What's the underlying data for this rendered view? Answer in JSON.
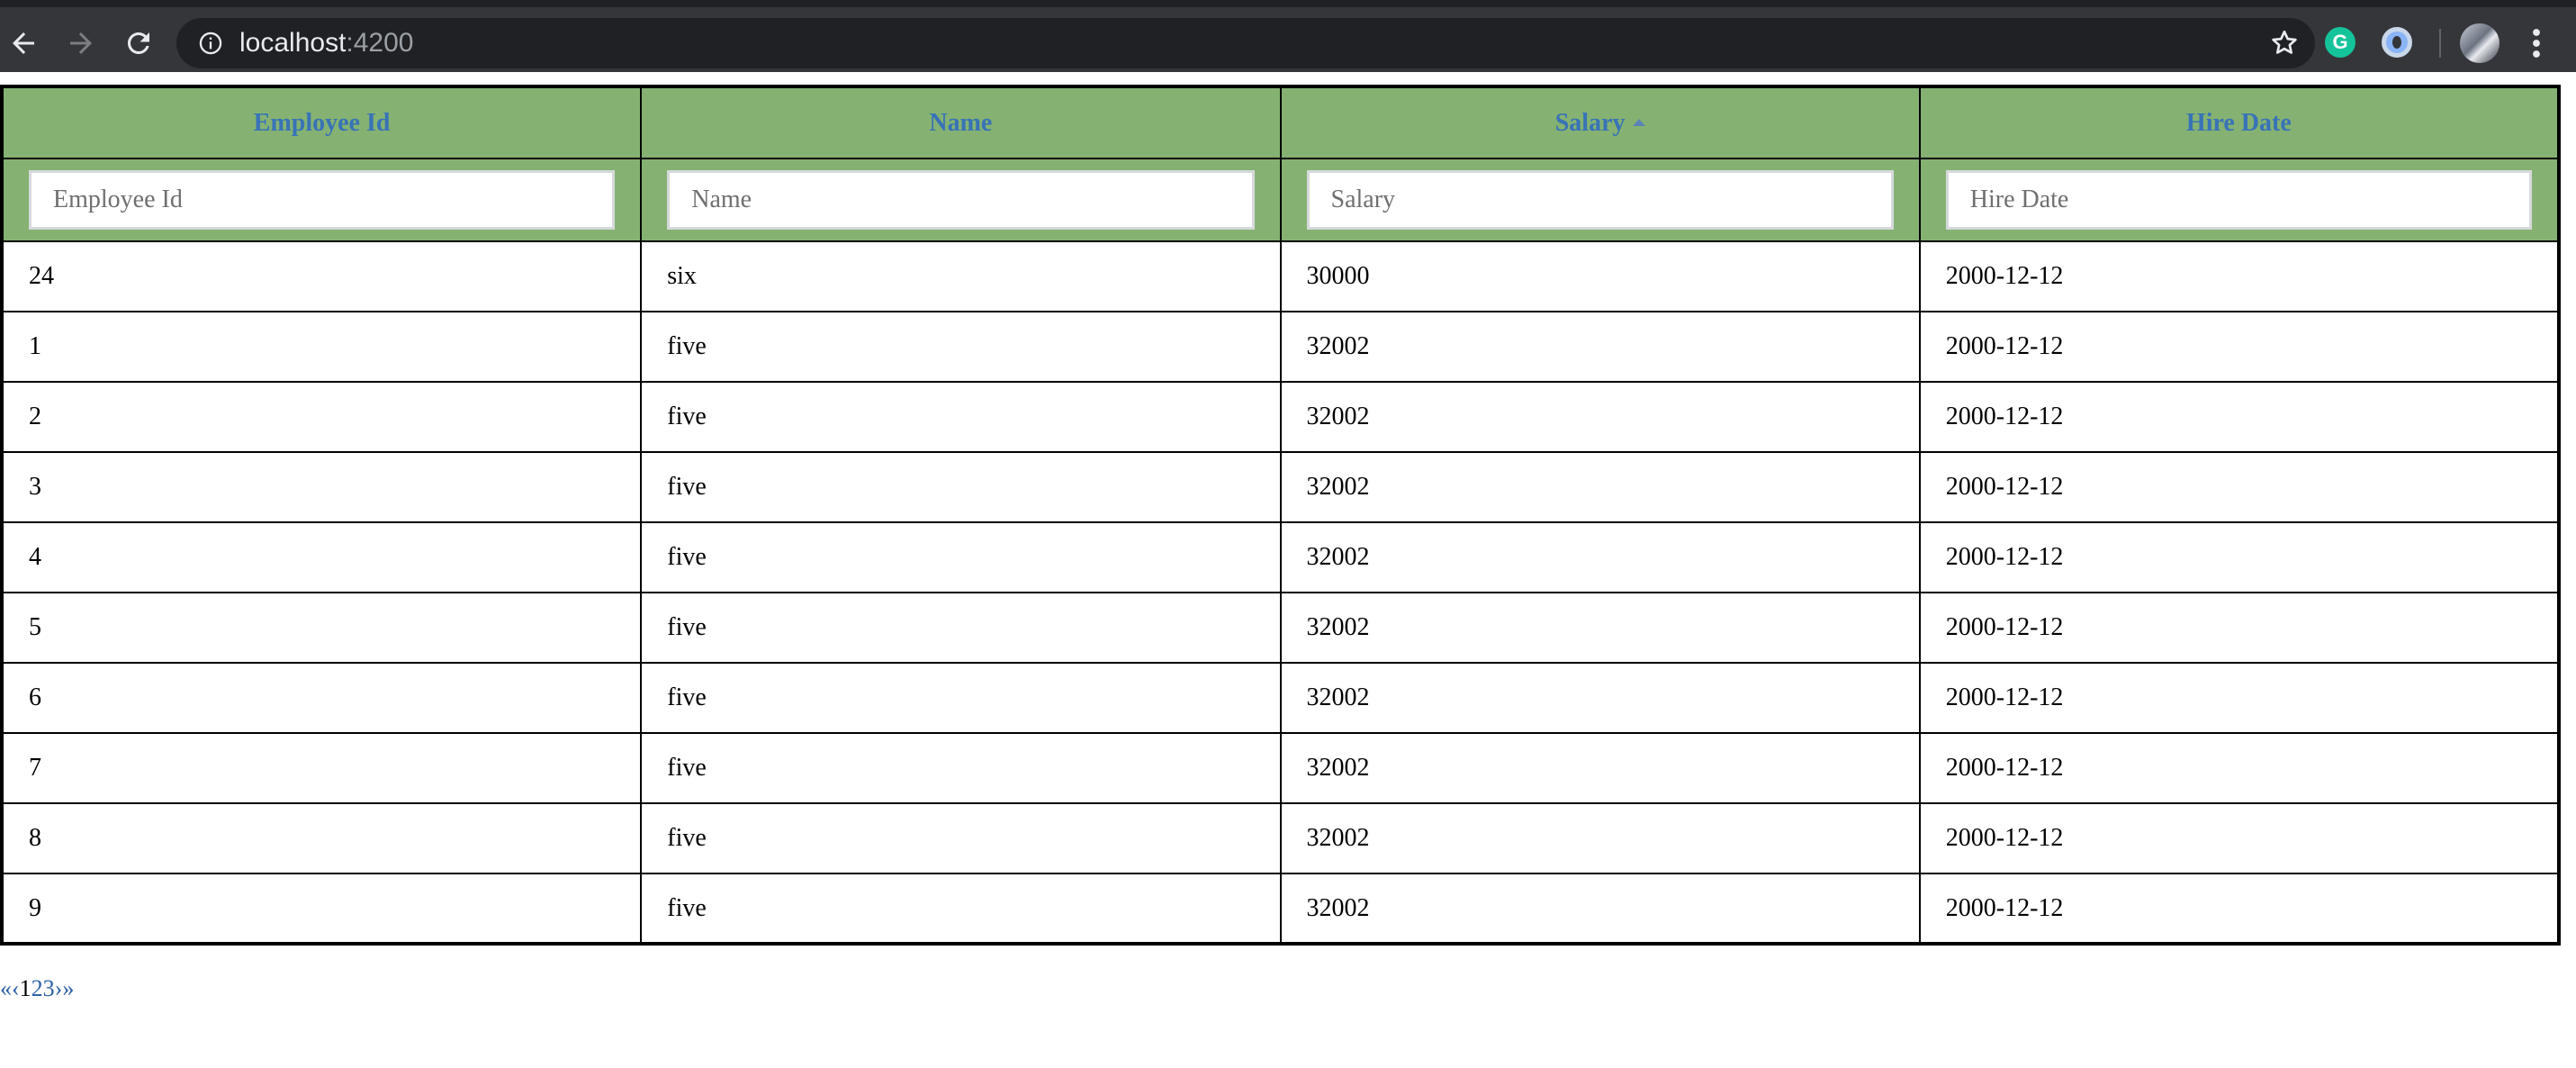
{
  "browser": {
    "url_host": "localhost",
    "url_port": ":4200",
    "extensions": [
      "grammarly-icon",
      "extension-icon"
    ]
  },
  "table": {
    "columns": [
      "Employee Id",
      "Name",
      "Salary",
      "Hire Date"
    ],
    "sorted_column": "Salary",
    "sort_direction": "ascending",
    "filters": [
      {
        "placeholder": "Employee Id",
        "value": ""
      },
      {
        "placeholder": "Name",
        "value": ""
      },
      {
        "placeholder": "Salary",
        "value": ""
      },
      {
        "placeholder": "Hire Date",
        "value": ""
      }
    ],
    "rows": [
      [
        "24",
        "six",
        "30000",
        "2000-12-12"
      ],
      [
        "1",
        "five",
        "32002",
        "2000-12-12"
      ],
      [
        "2",
        "five",
        "32002",
        "2000-12-12"
      ],
      [
        "3",
        "five",
        "32002",
        "2000-12-12"
      ],
      [
        "4",
        "five",
        "32002",
        "2000-12-12"
      ],
      [
        "5",
        "five",
        "32002",
        "2000-12-12"
      ],
      [
        "6",
        "five",
        "32002",
        "2000-12-12"
      ],
      [
        "7",
        "five",
        "32002",
        "2000-12-12"
      ],
      [
        "8",
        "five",
        "32002",
        "2000-12-12"
      ],
      [
        "9",
        "five",
        "32002",
        "2000-12-12"
      ]
    ]
  },
  "pagination": {
    "first": "«",
    "prev": "‹",
    "pages": [
      "1",
      "2",
      "3"
    ],
    "current": "1",
    "next": "›",
    "last": "»"
  },
  "colors": {
    "header_bg": "#85b272",
    "header_text": "#3873b7",
    "link": "#2f62a8",
    "chrome_bg": "#35363a"
  }
}
